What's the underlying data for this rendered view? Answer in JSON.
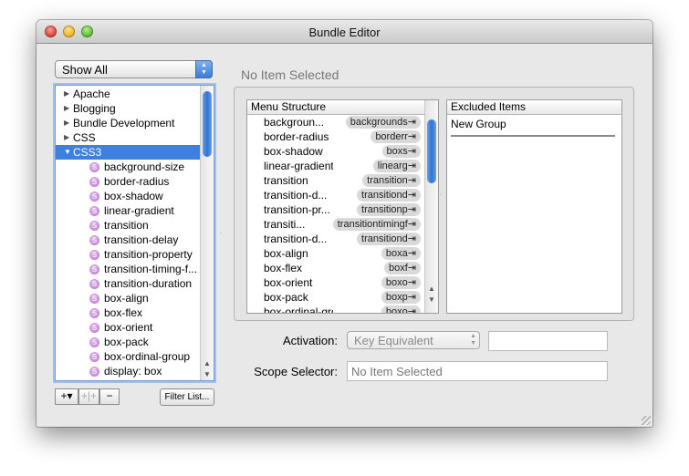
{
  "window": {
    "title": "Bundle Editor"
  },
  "filter_popup": {
    "label": "Show All"
  },
  "tree": {
    "items": [
      {
        "label": "Apache",
        "expanded": false
      },
      {
        "label": "Blogging",
        "expanded": false
      },
      {
        "label": "Bundle Development",
        "expanded": false
      },
      {
        "label": "CSS",
        "expanded": false
      },
      {
        "label": "CSS3",
        "expanded": true,
        "selected": true
      }
    ],
    "children": [
      "background-size",
      "border-radius",
      "box-shadow",
      "linear-gradient",
      "transition",
      "transition-delay",
      "transition-property",
      "transition-timing-f...",
      "transition-duration",
      "box-align",
      "box-flex",
      "box-orient",
      "box-pack",
      "box-ordinal-group",
      "display: box"
    ]
  },
  "bottom_buttons": {
    "add": "+▾",
    "add_group": "+|+",
    "remove": "−",
    "filter_list": "Filter List..."
  },
  "no_item_selected": "No Item Selected",
  "menu_structure": {
    "header": "Menu Structure",
    "rows": [
      {
        "name": "backgroun...",
        "trigger": "backgrounds⇥"
      },
      {
        "name": "border-radius",
        "trigger": "borderr⇥"
      },
      {
        "name": "box-shadow",
        "trigger": "boxs⇥"
      },
      {
        "name": "linear-gradient",
        "trigger": "linearg⇥"
      },
      {
        "name": "transition",
        "trigger": "transition⇥"
      },
      {
        "name": "transition-d...",
        "trigger": "transitiond⇥"
      },
      {
        "name": "transition-pr...",
        "trigger": "transitionp⇥"
      },
      {
        "name": "transiti...",
        "trigger": "transitiontimingf⇥"
      },
      {
        "name": "transition-d...",
        "trigger": "transitiond⇥"
      },
      {
        "name": "box-align",
        "trigger": "boxa⇥"
      },
      {
        "name": "box-flex",
        "trigger": "boxf⇥"
      },
      {
        "name": "box-orient",
        "trigger": "boxo⇥"
      },
      {
        "name": "box-pack",
        "trigger": "boxp⇥"
      },
      {
        "name": "box-ordinal-group",
        "trigger": "boxo⇥"
      }
    ]
  },
  "excluded_items": {
    "header": "Excluded Items",
    "items": [
      "New Group"
    ]
  },
  "activation": {
    "label": "Activation:",
    "value": "Key Equivalent",
    "key_field": ""
  },
  "scope_selector": {
    "label": "Scope Selector:",
    "value": "No Item Selected"
  }
}
